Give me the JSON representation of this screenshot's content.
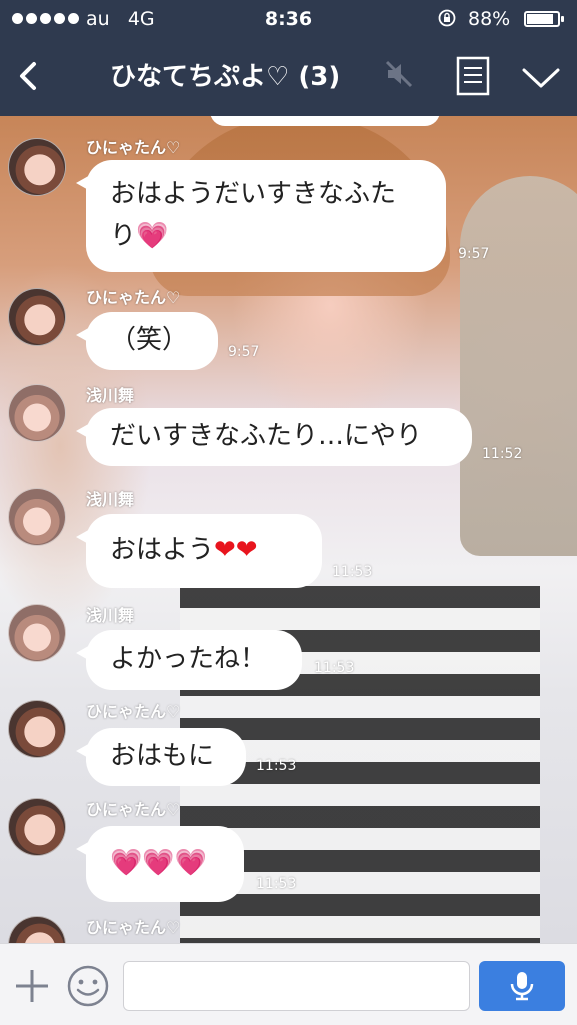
{
  "status_bar": {
    "carrier": "au",
    "network": "4G",
    "time": "8:36",
    "battery": "88%",
    "battery_level": 0.88
  },
  "header": {
    "title": "ひなてちぷよ♡ (3)",
    "back_icon": "chevron-left-icon",
    "mute_icon": "speaker-muted-icon",
    "notes_icon": "note-icon",
    "menu_icon": "chevron-down-icon"
  },
  "messages": [
    {
      "sender": "ひにゃたん♡",
      "text": "おはようだいすきなふた\nり",
      "emoji": "💗",
      "time": "9:57"
    },
    {
      "sender": "ひにゃたん♡",
      "text": "（笑）",
      "emoji": "",
      "time": "9:57"
    },
    {
      "sender": "浅川舞",
      "text": "だいすきなふたり…にやり",
      "emoji": "",
      "time": "11:52"
    },
    {
      "sender": "浅川舞",
      "text": "おはよう",
      "emoji": "❤❤",
      "time": "11:53"
    },
    {
      "sender": "浅川舞",
      "text": "よかったね！",
      "emoji": "",
      "time": "11:53"
    },
    {
      "sender": "ひにゃたん♡",
      "text": "おはもに",
      "emoji": "",
      "time": "11:53"
    },
    {
      "sender": "ひにゃたん♡",
      "text": "",
      "emoji": "💗💗💗",
      "time": "11:53"
    },
    {
      "sender": "ひにゃたん♡",
      "text": "",
      "emoji": "",
      "time": ""
    }
  ],
  "input_bar": {
    "plus_icon": "plus-icon",
    "sticker_icon": "smile-icon",
    "placeholder": "",
    "mic_icon": "microphone-icon",
    "accent": "#3b7fe0"
  },
  "colors": {
    "header_bg": "#2f3a4f",
    "bubble": "#ffffff"
  }
}
